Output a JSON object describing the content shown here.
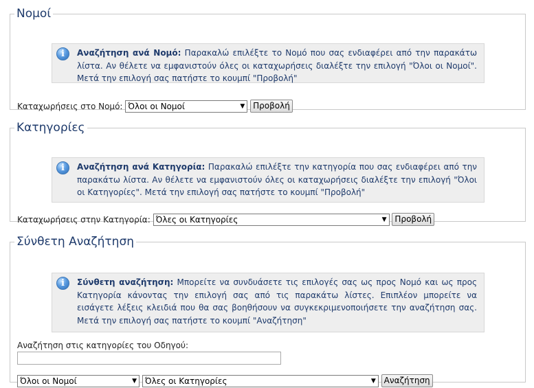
{
  "sections": {
    "nomoi": {
      "title": "Νομοί",
      "info_bold": "Αναζήτηση ανά Νομό:",
      "info_text": " Παρακαλώ επιλέξτε το Νομό που σας ενδιαφέρει από την παρακάτω λίστα. Αν θέλετε να εμφανιστούν όλες οι καταχωρήσεις διαλέξτε την επιλογή \"Όλοι οι Νομοί\". Μετά την επιλογή σας πατήστε το κουμπί \"Προβολή\"",
      "row_label": "Καταχωρήσεις στο Νομό:",
      "select_value": "Όλοι οι Νομοί",
      "button_label": "Προβολή"
    },
    "kathgories": {
      "title": "Κατηγορίες",
      "info_bold": "Αναζήτηση ανά Κατηγορία:",
      "info_text": " Παρακαλώ επιλέξτε την κατηγορία που σας ενδιαφέρει από την παρακάτω λίστα. Αν θέλετε να εμφανιστούν όλες οι καταχωρήσεις διαλέξτε την επιλογή \"Όλοι οι Κατηγορίες\". Μετά την επιλογή σας πατήστε το κουμπί \"Προβολή\"",
      "row_label": "Καταχωρήσεις στην Κατηγορία:",
      "select_value": "Όλες οι Κατηγορίες",
      "button_label": "Προβολή"
    },
    "syntheti": {
      "title": "Σύνθετη Αναζήτηση",
      "info_bold": "Σύνθετη αναζήτηση:",
      "info_text": " Μπορείτε να συνδυάσετε τις επιλογές σας ως προς Νομό και ως προς Κατηγορία κάνοντας την επιλογή σας από τις παρακάτω λίστες. Επιπλέον μπορείτε να εισάγετε λέξεις κλειδιά που θα σας βοηθήσουν να συγκεκριμενοποιήσετε την αναζήτηση σας. Μετά την επιλογή σας πατήστε το κουμπί \"Αναζήτηση\"",
      "search_label": "Αναζήτηση στις κατηγορίες του Οδηγού:",
      "search_value": "",
      "select_nomos_value": "Όλοι οι Νομοί",
      "select_kathgoria_value": "Όλες οι Κατηγορίες",
      "button_label": "Αναζήτηση"
    }
  },
  "icons": {
    "info": "info-icon",
    "dropdown": "chevron-down-icon"
  },
  "colors": {
    "title": "#1e3a6b",
    "info_bg": "#eeeeee",
    "border": "#c8c8c8"
  }
}
